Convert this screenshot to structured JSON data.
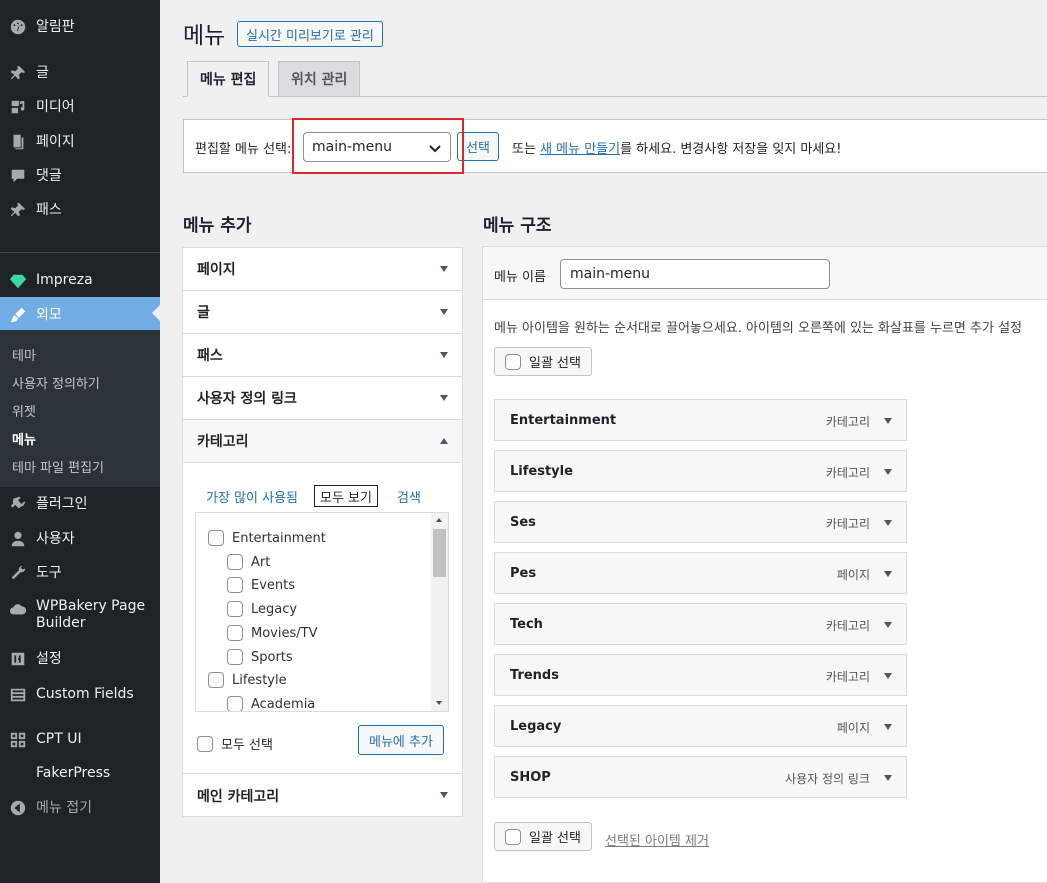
{
  "sidebar": {
    "items": [
      {
        "label": "알림판",
        "icon": "dashboard-icon"
      },
      {
        "label": "글",
        "icon": "pin-icon"
      },
      {
        "label": "미디어",
        "icon": "media-icon"
      },
      {
        "label": "페이지",
        "icon": "page-icon"
      },
      {
        "label": "댓글",
        "icon": "comment-icon"
      },
      {
        "label": "패스",
        "icon": "pin-icon"
      },
      {
        "label": "Impreza",
        "icon": "gem-icon"
      },
      {
        "label": "외모",
        "icon": "brush-icon"
      },
      {
        "label": "플러그인",
        "icon": "plugin-icon"
      },
      {
        "label": "사용자",
        "icon": "user-icon"
      },
      {
        "label": "도구",
        "icon": "wrench-icon"
      },
      {
        "label": "WPBakery Page Builder",
        "icon": "cloud-icon"
      },
      {
        "label": "설정",
        "icon": "settings-icon"
      },
      {
        "label": "Custom Fields",
        "icon": "fields-icon"
      },
      {
        "label": "CPT UI",
        "icon": "grid-icon"
      },
      {
        "label": "FakerPress",
        "icon": ""
      },
      {
        "label": "메뉴 접기",
        "icon": "collapse-icon"
      }
    ],
    "submenu": [
      "테마",
      "사용자 정의하기",
      "위젯",
      "메뉴",
      "테마 파일 편집기"
    ]
  },
  "header": {
    "title": "메뉴",
    "live_preview": "실시간 미리보기로 관리",
    "tabs": [
      "메뉴 편집",
      "위치 관리"
    ]
  },
  "manage": {
    "label": "편집할 메뉴 선택:",
    "selected": "main-menu",
    "select_button": "선택",
    "or_prefix": "또는",
    "create_link": "새 메뉴 만들기",
    "or_suffix": "를 하세요. 변경사항 저장을 잊지 마세요!"
  },
  "add_menu": {
    "title": "메뉴 추가",
    "sections": [
      "페이지",
      "글",
      "패스",
      "사용자 정의 링크",
      "카테고리",
      "메인 카테고리"
    ],
    "category_tabs": [
      "가장 많이 사용됨",
      "모두 보기",
      "검색"
    ],
    "categories": [
      {
        "label": "Entertainment",
        "level": 0
      },
      {
        "label": "Art",
        "level": 1
      },
      {
        "label": "Events",
        "level": 1
      },
      {
        "label": "Legacy",
        "level": 1
      },
      {
        "label": "Movies/TV",
        "level": 1
      },
      {
        "label": "Sports",
        "level": 1
      },
      {
        "label": "Lifestyle",
        "level": 0
      },
      {
        "label": "Academia",
        "level": 1
      }
    ],
    "select_all": "모두 선택",
    "add_button": "메뉴에 추가"
  },
  "structure": {
    "title": "메뉴 구조",
    "name_label": "메뉴 이름",
    "name_value": "main-menu",
    "instructions": "메뉴 아이템을 원하는 순서대로 끌어놓으세요. 아이템의 오른쪽에 있는 화살표를 누르면 추가 설정",
    "bulk_select": "일괄 선택",
    "remove_selected": "선택된 아이템 제거",
    "items": [
      {
        "title": "Entertainment",
        "type": "카테고리"
      },
      {
        "title": "Lifestyle",
        "type": "카테고리"
      },
      {
        "title": "Ses",
        "type": "카테고리"
      },
      {
        "title": "Pes",
        "type": "페이지"
      },
      {
        "title": "Tech",
        "type": "카테고리"
      },
      {
        "title": "Trends",
        "type": "카테고리"
      },
      {
        "title": "Legacy",
        "type": "페이지"
      },
      {
        "title": "SHOP",
        "type": "사용자 정의 링크"
      }
    ]
  },
  "colors": {
    "sidebar_bg": "#1d2327",
    "active_menu": "#72aee6",
    "link": "#2271b1",
    "highlight": "#e0262d"
  }
}
